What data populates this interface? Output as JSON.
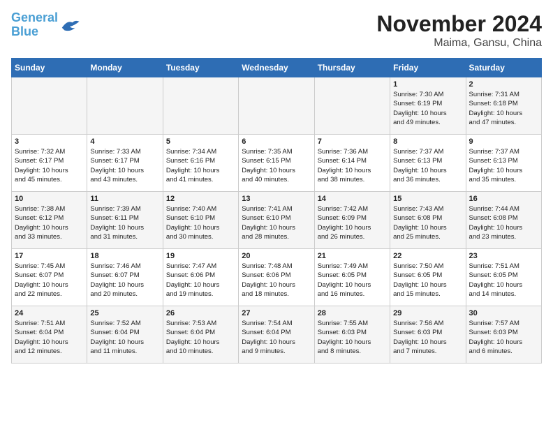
{
  "logo": {
    "line1": "General",
    "line2": "Blue"
  },
  "title": "November 2024",
  "subtitle": "Maima, Gansu, China",
  "header": {
    "days": [
      "Sunday",
      "Monday",
      "Tuesday",
      "Wednesday",
      "Thursday",
      "Friday",
      "Saturday"
    ]
  },
  "weeks": [
    {
      "cells": [
        {
          "day": "",
          "content": ""
        },
        {
          "day": "",
          "content": ""
        },
        {
          "day": "",
          "content": ""
        },
        {
          "day": "",
          "content": ""
        },
        {
          "day": "",
          "content": ""
        },
        {
          "day": "1",
          "content": "Sunrise: 7:30 AM\nSunset: 6:19 PM\nDaylight: 10 hours\nand 49 minutes."
        },
        {
          "day": "2",
          "content": "Sunrise: 7:31 AM\nSunset: 6:18 PM\nDaylight: 10 hours\nand 47 minutes."
        }
      ]
    },
    {
      "cells": [
        {
          "day": "3",
          "content": "Sunrise: 7:32 AM\nSunset: 6:17 PM\nDaylight: 10 hours\nand 45 minutes."
        },
        {
          "day": "4",
          "content": "Sunrise: 7:33 AM\nSunset: 6:17 PM\nDaylight: 10 hours\nand 43 minutes."
        },
        {
          "day": "5",
          "content": "Sunrise: 7:34 AM\nSunset: 6:16 PM\nDaylight: 10 hours\nand 41 minutes."
        },
        {
          "day": "6",
          "content": "Sunrise: 7:35 AM\nSunset: 6:15 PM\nDaylight: 10 hours\nand 40 minutes."
        },
        {
          "day": "7",
          "content": "Sunrise: 7:36 AM\nSunset: 6:14 PM\nDaylight: 10 hours\nand 38 minutes."
        },
        {
          "day": "8",
          "content": "Sunrise: 7:37 AM\nSunset: 6:13 PM\nDaylight: 10 hours\nand 36 minutes."
        },
        {
          "day": "9",
          "content": "Sunrise: 7:37 AM\nSunset: 6:13 PM\nDaylight: 10 hours\nand 35 minutes."
        }
      ]
    },
    {
      "cells": [
        {
          "day": "10",
          "content": "Sunrise: 7:38 AM\nSunset: 6:12 PM\nDaylight: 10 hours\nand 33 minutes."
        },
        {
          "day": "11",
          "content": "Sunrise: 7:39 AM\nSunset: 6:11 PM\nDaylight: 10 hours\nand 31 minutes."
        },
        {
          "day": "12",
          "content": "Sunrise: 7:40 AM\nSunset: 6:10 PM\nDaylight: 10 hours\nand 30 minutes."
        },
        {
          "day": "13",
          "content": "Sunrise: 7:41 AM\nSunset: 6:10 PM\nDaylight: 10 hours\nand 28 minutes."
        },
        {
          "day": "14",
          "content": "Sunrise: 7:42 AM\nSunset: 6:09 PM\nDaylight: 10 hours\nand 26 minutes."
        },
        {
          "day": "15",
          "content": "Sunrise: 7:43 AM\nSunset: 6:08 PM\nDaylight: 10 hours\nand 25 minutes."
        },
        {
          "day": "16",
          "content": "Sunrise: 7:44 AM\nSunset: 6:08 PM\nDaylight: 10 hours\nand 23 minutes."
        }
      ]
    },
    {
      "cells": [
        {
          "day": "17",
          "content": "Sunrise: 7:45 AM\nSunset: 6:07 PM\nDaylight: 10 hours\nand 22 minutes."
        },
        {
          "day": "18",
          "content": "Sunrise: 7:46 AM\nSunset: 6:07 PM\nDaylight: 10 hours\nand 20 minutes."
        },
        {
          "day": "19",
          "content": "Sunrise: 7:47 AM\nSunset: 6:06 PM\nDaylight: 10 hours\nand 19 minutes."
        },
        {
          "day": "20",
          "content": "Sunrise: 7:48 AM\nSunset: 6:06 PM\nDaylight: 10 hours\nand 18 minutes."
        },
        {
          "day": "21",
          "content": "Sunrise: 7:49 AM\nSunset: 6:05 PM\nDaylight: 10 hours\nand 16 minutes."
        },
        {
          "day": "22",
          "content": "Sunrise: 7:50 AM\nSunset: 6:05 PM\nDaylight: 10 hours\nand 15 minutes."
        },
        {
          "day": "23",
          "content": "Sunrise: 7:51 AM\nSunset: 6:05 PM\nDaylight: 10 hours\nand 14 minutes."
        }
      ]
    },
    {
      "cells": [
        {
          "day": "24",
          "content": "Sunrise: 7:51 AM\nSunset: 6:04 PM\nDaylight: 10 hours\nand 12 minutes."
        },
        {
          "day": "25",
          "content": "Sunrise: 7:52 AM\nSunset: 6:04 PM\nDaylight: 10 hours\nand 11 minutes."
        },
        {
          "day": "26",
          "content": "Sunrise: 7:53 AM\nSunset: 6:04 PM\nDaylight: 10 hours\nand 10 minutes."
        },
        {
          "day": "27",
          "content": "Sunrise: 7:54 AM\nSunset: 6:04 PM\nDaylight: 10 hours\nand 9 minutes."
        },
        {
          "day": "28",
          "content": "Sunrise: 7:55 AM\nSunset: 6:03 PM\nDaylight: 10 hours\nand 8 minutes."
        },
        {
          "day": "29",
          "content": "Sunrise: 7:56 AM\nSunset: 6:03 PM\nDaylight: 10 hours\nand 7 minutes."
        },
        {
          "day": "30",
          "content": "Sunrise: 7:57 AM\nSunset: 6:03 PM\nDaylight: 10 hours\nand 6 minutes."
        }
      ]
    }
  ]
}
